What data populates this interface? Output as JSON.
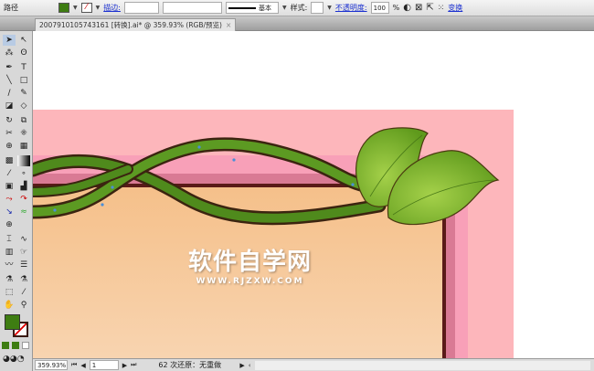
{
  "control_bar": {
    "path_label": "路径",
    "stroke_label": "描边:",
    "stroke_value": "",
    "brush_value": "",
    "profile_label": "基本",
    "style_label": "样式:",
    "opacity_label": "不透明度:",
    "opacity_value": "100",
    "opacity_unit": "%",
    "transform_label": "变换"
  },
  "document_tab": {
    "title": "2007910105743161 [转换].ai* @ 359.93% (RGB/预览)",
    "close": "×"
  },
  "status_bar": {
    "zoom": "359.93%",
    "page": "1",
    "status_text": "62 次还原：无重做"
  },
  "watermark": {
    "title": "软件自学网",
    "url": "WWW.RJZXW.COM"
  },
  "colors": {
    "fill": "#3e7d12",
    "canvas_pink": "#fdb6bb",
    "canvas_peach": "#f6c590",
    "accent": "#1a2fd0"
  }
}
